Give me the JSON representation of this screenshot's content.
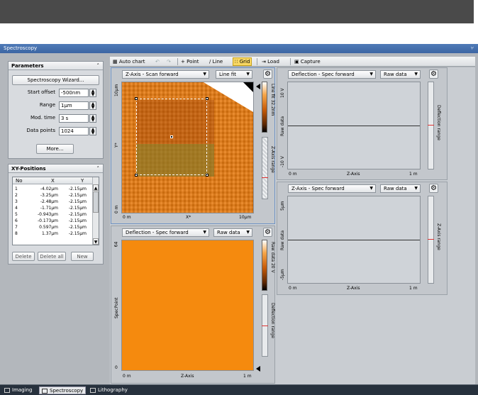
{
  "window": {
    "title": "Spectroscopy",
    "pin": "⑂"
  },
  "parameters": {
    "header": "Parameters",
    "wizard_label": "Spectroscopy Wizard...",
    "fields": [
      {
        "label": "Start offset",
        "value": "-500nm"
      },
      {
        "label": "Range",
        "value": "1µm"
      },
      {
        "label": "Mod. time",
        "value": "3 s"
      },
      {
        "label": "Data points",
        "value": "1024"
      }
    ],
    "more_label": "More..."
  },
  "xy_positions": {
    "header": "XY-Positions",
    "columns": [
      "No",
      "X",
      "Y"
    ],
    "rows": [
      [
        "1",
        "-4.02µm",
        "-2.15µm"
      ],
      [
        "2",
        "-3.25µm",
        "-2.15µm"
      ],
      [
        "3",
        "-2.48µm",
        "-2.15µm"
      ],
      [
        "4",
        "-1.71µm",
        "-2.15µm"
      ],
      [
        "5",
        "-0.943µm",
        "-2.15µm"
      ],
      [
        "6",
        "-0.173µm",
        "-2.15µm"
      ],
      [
        "7",
        "0.597µm",
        "-2.15µm"
      ],
      [
        "8",
        "1.37µm",
        "-2.15µm"
      ]
    ],
    "delete_label": "Delete",
    "delete_all_label": "Delete all",
    "new_label": "New"
  },
  "toolbar": {
    "auto_chart": "Auto chart",
    "point": "Point",
    "line": "Line",
    "grid": "Grid",
    "load": "Load",
    "capture": "Capture"
  },
  "chart_image": {
    "dd1": "Z-Axis - Scan forward",
    "dd2": "Line fit",
    "y_top": "10µm",
    "y_mid": "Y*",
    "y_bot": "0 m",
    "x_left": "0 m",
    "x_mid": "X*",
    "x_right": "10µm",
    "colorbar_label": "Line fit 32.2nm",
    "range_label": "Z-Axis range"
  },
  "chart_spec_grid": {
    "dd1": "Deflection - Spec forward",
    "dd2": "Raw data",
    "y_top": "64",
    "y_mid": "SpecPoint",
    "y_bot": "0",
    "x_left": "0 m",
    "x_mid": "Z-Axis",
    "x_right": "1 m",
    "colorbar_label": "Raw data 20 V",
    "range_label": "Deflection range"
  },
  "chart_defl": {
    "dd1": "Deflection - Spec forward",
    "dd2": "Raw data",
    "y_top": "10 V",
    "y_mid": "Raw data",
    "y_bot": "-10 V",
    "x_left": "0 m",
    "x_mid": "Z-Axis",
    "x_right": "1 m",
    "range_label": "Deflection range"
  },
  "chart_z": {
    "dd1": "Z-Axis - Spec forward",
    "dd2": "Raw data",
    "y_top": "5µm",
    "y_mid": "Raw data",
    "y_bot": "-5µm",
    "x_left": "0 m",
    "x_mid": "Z-Axis",
    "x_right": "1 m",
    "range_label": "Z-Axis range"
  },
  "bottom_tabs": [
    "Imaging",
    "Spectroscopy",
    "Lithography"
  ],
  "colors": {
    "orange": "#f58a0e",
    "accent": "#4f7bb8"
  }
}
